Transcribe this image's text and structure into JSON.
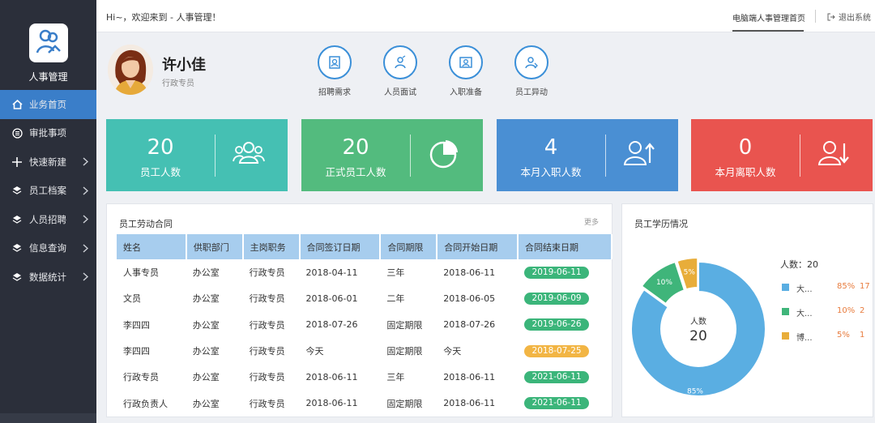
{
  "app": {
    "name": "人事管理"
  },
  "sidebar": {
    "items": [
      {
        "label": "业务首页",
        "icon": "home-icon",
        "active": true,
        "has_chevron": false
      },
      {
        "label": "审批事项",
        "icon": "list-icon",
        "active": false,
        "has_chevron": false
      },
      {
        "label": "快速新建",
        "icon": "plus-icon",
        "active": false,
        "has_chevron": true
      },
      {
        "label": "员工档案",
        "icon": "layers-icon",
        "active": false,
        "has_chevron": true
      },
      {
        "label": "人员招聘",
        "icon": "layers-icon",
        "active": false,
        "has_chevron": true
      },
      {
        "label": "信息查询",
        "icon": "layers-icon",
        "active": false,
        "has_chevron": true
      },
      {
        "label": "数据统计",
        "icon": "layers-icon",
        "active": false,
        "has_chevron": true
      }
    ]
  },
  "topbar": {
    "greeting": "Hi~，欢迎来到 - 人事管理！",
    "home_tab": "电脑端人事管理首页",
    "logout": "退出系统"
  },
  "profile": {
    "name": "许小佳",
    "role": "行政专员"
  },
  "quick_actions": [
    {
      "label": "招聘需求",
      "icon": "recruit-icon"
    },
    {
      "label": "人员面试",
      "icon": "interview-icon"
    },
    {
      "label": "入职准备",
      "icon": "onboarding-icon"
    },
    {
      "label": "员工异动",
      "icon": "transfer-icon"
    }
  ],
  "stats": [
    {
      "value": "20",
      "label": "员工人数",
      "color": "#45c0b3",
      "icon": "group-icon"
    },
    {
      "value": "20",
      "label": "正式员工人数",
      "color": "#53bb7e",
      "icon": "pie-icon"
    },
    {
      "value": "4",
      "label": "本月入职人数",
      "color": "#4a8fd3",
      "icon": "user-up-icon"
    },
    {
      "value": "0",
      "label": "本月离职人数",
      "color": "#e9544f",
      "icon": "user-down-icon"
    }
  ],
  "contracts": {
    "title": "员工劳动合同",
    "more": "更多",
    "columns": [
      "姓名",
      "供职部门",
      "主岗职务",
      "合同签订日期",
      "合同期限",
      "合同开始日期",
      "合同结束日期"
    ],
    "rows": [
      {
        "name": "人事专员",
        "dept": "办公室",
        "post": "行政专员",
        "sign": "2018-04-11",
        "term": "三年",
        "start": "2018-06-11",
        "end": "2019-06-11",
        "end_color": "#3bb57a"
      },
      {
        "name": "文员",
        "dept": "办公室",
        "post": "行政专员",
        "sign": "2018-06-01",
        "term": "二年",
        "start": "2018-06-05",
        "end": "2019-06-09",
        "end_color": "#3bb57a"
      },
      {
        "name": "李四四",
        "dept": "办公室",
        "post": "行政专员",
        "sign": "2018-07-26",
        "term": "固定期限",
        "start": "2018-07-26",
        "end": "2019-06-26",
        "end_color": "#3bb57a"
      },
      {
        "name": "李四四",
        "dept": "办公室",
        "post": "行政专员",
        "sign": "今天",
        "term": "固定期限",
        "start": "今天",
        "end": "2018-07-25",
        "end_color": "#f2b544"
      },
      {
        "name": "行政专员",
        "dept": "办公室",
        "post": "行政专员",
        "sign": "2018-06-11",
        "term": "三年",
        "start": "2018-06-11",
        "end": "2021-06-11",
        "end_color": "#3bb57a"
      },
      {
        "name": "行政负责人",
        "dept": "办公室",
        "post": "行政专员",
        "sign": "2018-06-11",
        "term": "固定期限",
        "start": "2018-06-11",
        "end": "2021-06-11",
        "end_color": "#3bb57a"
      }
    ]
  },
  "education": {
    "title": "员工学历情况",
    "legend_title": "人数：20",
    "center_label": "人数",
    "center_value": "20"
  },
  "chart_data": {
    "type": "pie",
    "donut": true,
    "total": 20,
    "series": [
      {
        "name": "大...",
        "percent": 85,
        "count": 17,
        "color": "#5aaee2"
      },
      {
        "name": "大...",
        "percent": 10,
        "count": 2,
        "color": "#3fb57a"
      },
      {
        "name": "博...",
        "percent": 5,
        "count": 1,
        "color": "#e8ad3a"
      }
    ]
  }
}
